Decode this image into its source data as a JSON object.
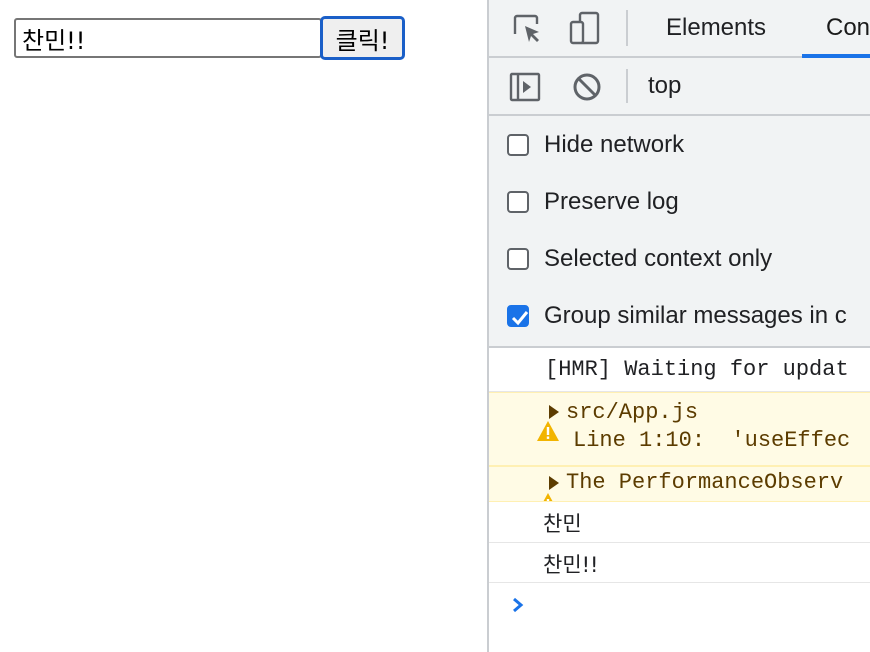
{
  "page": {
    "input_value": "찬민!!",
    "button_label": "클릭!"
  },
  "devtools": {
    "tabs": [
      "Elements",
      "Con"
    ],
    "active_tab": "Con",
    "context": "top",
    "settings": [
      {
        "label": "Hide network",
        "checked": false
      },
      {
        "label": "Preserve log",
        "checked": false
      },
      {
        "label": "Selected context only",
        "checked": false
      },
      {
        "label": "Group similar messages in c",
        "checked": true
      }
    ],
    "console": [
      {
        "type": "log",
        "text": "[HMR] Waiting for updat"
      },
      {
        "type": "warning",
        "line1": "src/App.js",
        "line2": "Line 1:10:  'useEffec"
      },
      {
        "type": "warning",
        "line1": "The PerformanceObserv"
      },
      {
        "type": "log",
        "text": "찬민"
      },
      {
        "type": "log",
        "text": "찬민!!"
      }
    ]
  },
  "icons": {
    "inspect": "inspect-element-icon",
    "device": "device-toolbar-icon",
    "sidebar": "console-sidebar-icon",
    "clear": "clear-console-icon",
    "warning": "warning-icon",
    "expand": "expand-triangle-icon",
    "prompt": "console-prompt-icon"
  },
  "colors": {
    "accent": "#1a73e8",
    "warning_bg": "#fffbe5",
    "warning_text": "#5c3c00",
    "warning_icon": "#f2b400",
    "panel_bg": "#f1f3f4"
  }
}
